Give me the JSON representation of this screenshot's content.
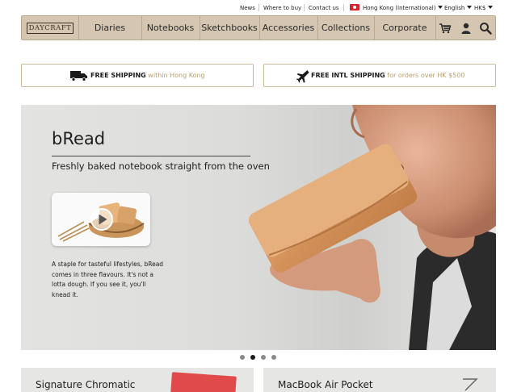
{
  "topbar": {
    "news": "News",
    "where_to_buy": "Where to buy",
    "contact_us": "Contact us",
    "region": "Hong Kong (International)",
    "language": "English",
    "currency": "HK$"
  },
  "nav": {
    "logo": "DAYCRAFT",
    "items": [
      "Diaries",
      "Notebooks",
      "Sketchbooks",
      "Accessories",
      "Collections",
      "Corporate"
    ],
    "icons": [
      "cart-icon",
      "user-icon",
      "search-icon"
    ]
  },
  "shipping": {
    "local": {
      "strong": "FREE SHIPPING",
      "muted": "within Hong Kong",
      "icon": "truck-icon"
    },
    "intl": {
      "strong": "FREE INTL SHIPPING",
      "muted": "for orders over HK $500",
      "icon": "airplane-icon"
    }
  },
  "hero": {
    "title": "bRead",
    "subtitle": "Freshly baked notebook straight from the oven",
    "description": "A staple for tasteful lifestyles, bRead comes in three flavours. It's not a lotta dough. If you see it, you'll knead it.",
    "video_icon": "play-icon",
    "slides": 4,
    "active_slide": 2
  },
  "cards": [
    {
      "title": "Signature Chromatic"
    },
    {
      "title": "MacBook Air Pocket"
    }
  ],
  "colors": {
    "nav_bg": "#d4c6b1",
    "accent_muted": "#b8a070",
    "flag": "#d8242c"
  }
}
